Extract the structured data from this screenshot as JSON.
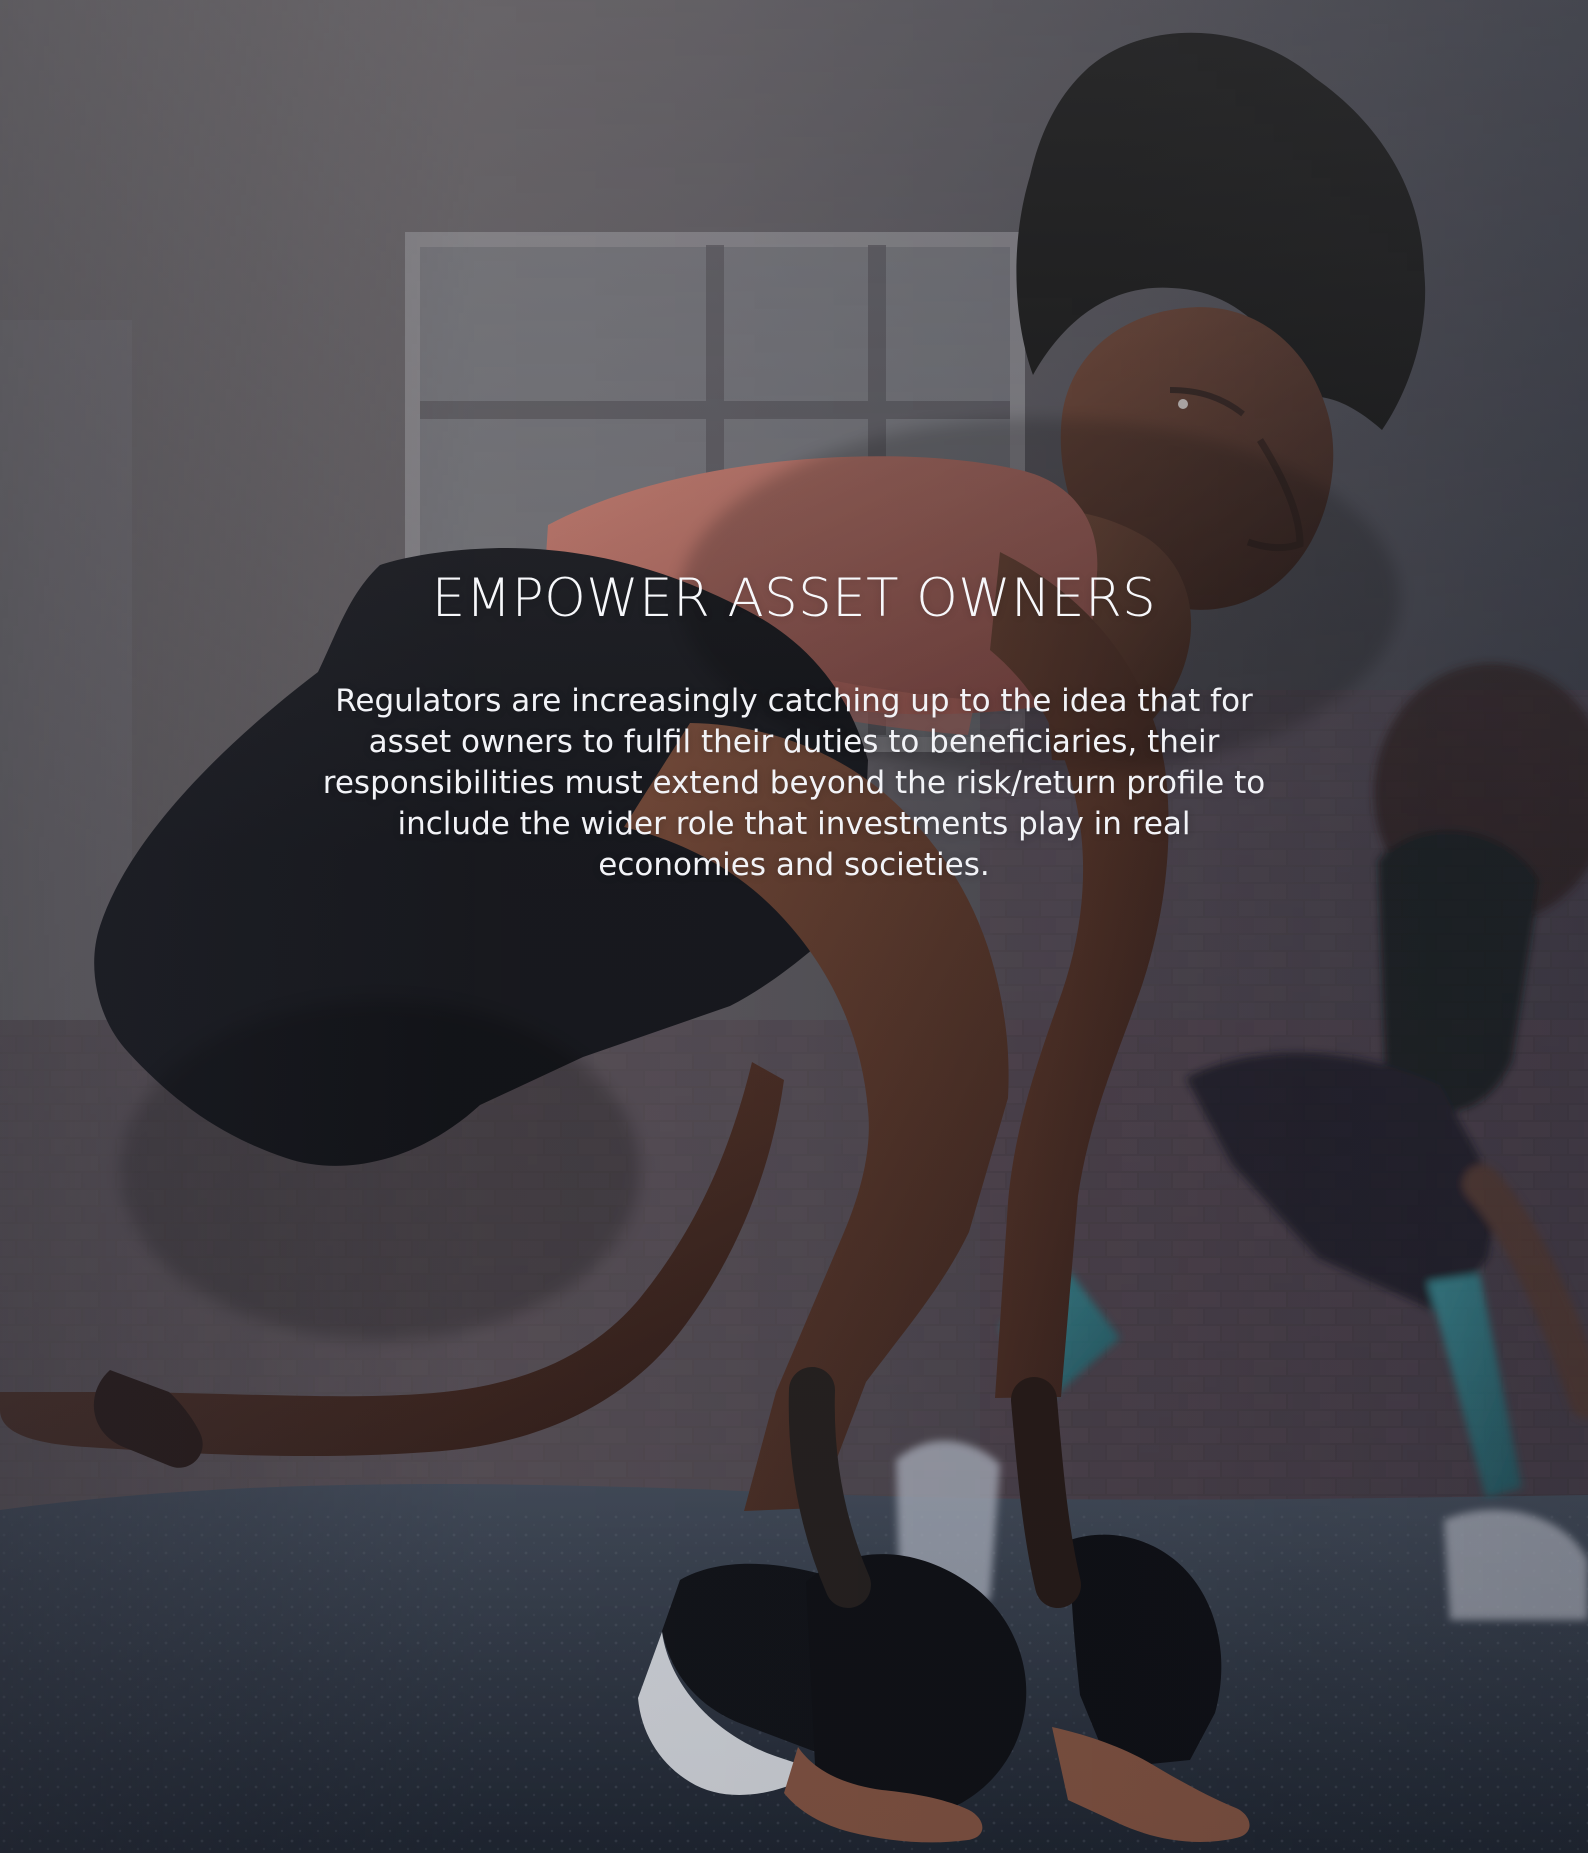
{
  "hero": {
    "title": "EMPOWER ASSET OWNERS",
    "body": "Regulators are increasingly catching up to the idea that for asset owners to fulfil their duties to beneficiaries, their responsibilities must extend beyond the risk/return profile to include the wider role that investments play in real economies and societies."
  },
  "icons": {
    "main_person": "runner-illustration",
    "background_person": "athlete-illustration"
  },
  "colors": {
    "title_text": "#f7f8fb",
    "body_text": "#f2f3f7",
    "top_wash": "#8a8585",
    "bottom_shadow": "#1c2029",
    "coral_top": "#d47a6d",
    "teal_leggings": "#2ba2ad",
    "dark_clothing": "#16181e"
  }
}
